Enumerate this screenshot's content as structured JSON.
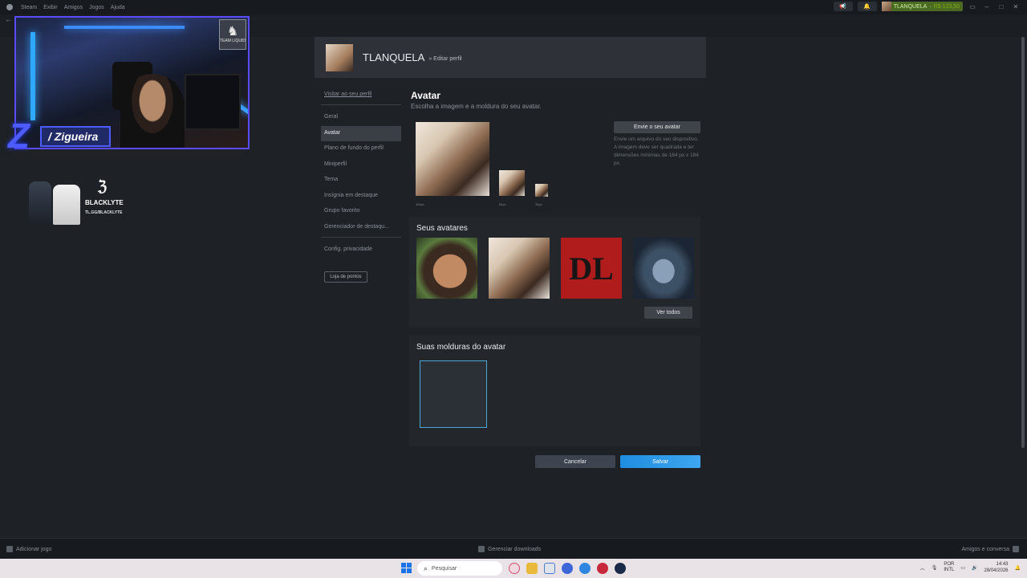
{
  "steam_menu": [
    "Steam",
    "Exibir",
    "Amigos",
    "Jogos",
    "Ajuda"
  ],
  "user": {
    "name": "TLANQUELA",
    "balance": "R$ 123,50"
  },
  "stream": {
    "streamer_name": "/ Zigueira",
    "team_logo_text": "TEAM LIQUID",
    "sponsor_brand": "BLACKLYTE",
    "sponsor_url": "TL.GG/BLACKLYTE"
  },
  "profile": {
    "name": "TLANQUELA",
    "subtitle": "» Editar perfil"
  },
  "nav": {
    "visit": "Visitar ao seu perfil",
    "items": [
      "Geral",
      "Avatar",
      "Plano de fundo do perfil",
      "Miniperfil",
      "Tema",
      "Insígnia em destaque",
      "Grupo favorito",
      "Gerenciador de destaqu..."
    ],
    "privacy": "Config. privacidade",
    "points_shop": "Loja de pontos",
    "active_index": 1
  },
  "avatar_section": {
    "title": "Avatar",
    "description": "Escolha a imagem e a moldura do seu avatar.",
    "sizes": [
      "184px",
      "64px",
      "32px"
    ],
    "upload_button": "Envie o seu avatar",
    "upload_help": "Envie um arquivo do seu dispositivo. A imagem deve ser quadrada e ter dimensões mínimas de 184 px x 184 px."
  },
  "your_avatars": {
    "title": "Seus avatares",
    "see_all": "Ver todos",
    "third_avatar_text": "DL"
  },
  "frames": {
    "title": "Suas molduras do avatar"
  },
  "actions": {
    "cancel": "Cancelar",
    "save": "Salvar"
  },
  "bottom_bar": {
    "add_game": "Adicionar jogo",
    "downloads": "Gerenciar downloads",
    "friends": "Amigos e conversa"
  },
  "taskbar": {
    "search_placeholder": "Pesquisar",
    "lang_1": "POR",
    "lang_2": "INTL",
    "time": "14:43",
    "date": "28/04/2026"
  },
  "colors": {
    "accent_save": "#2f98e8",
    "frame_border": "#4aa8d6",
    "stream_border": "#5a4bff"
  }
}
